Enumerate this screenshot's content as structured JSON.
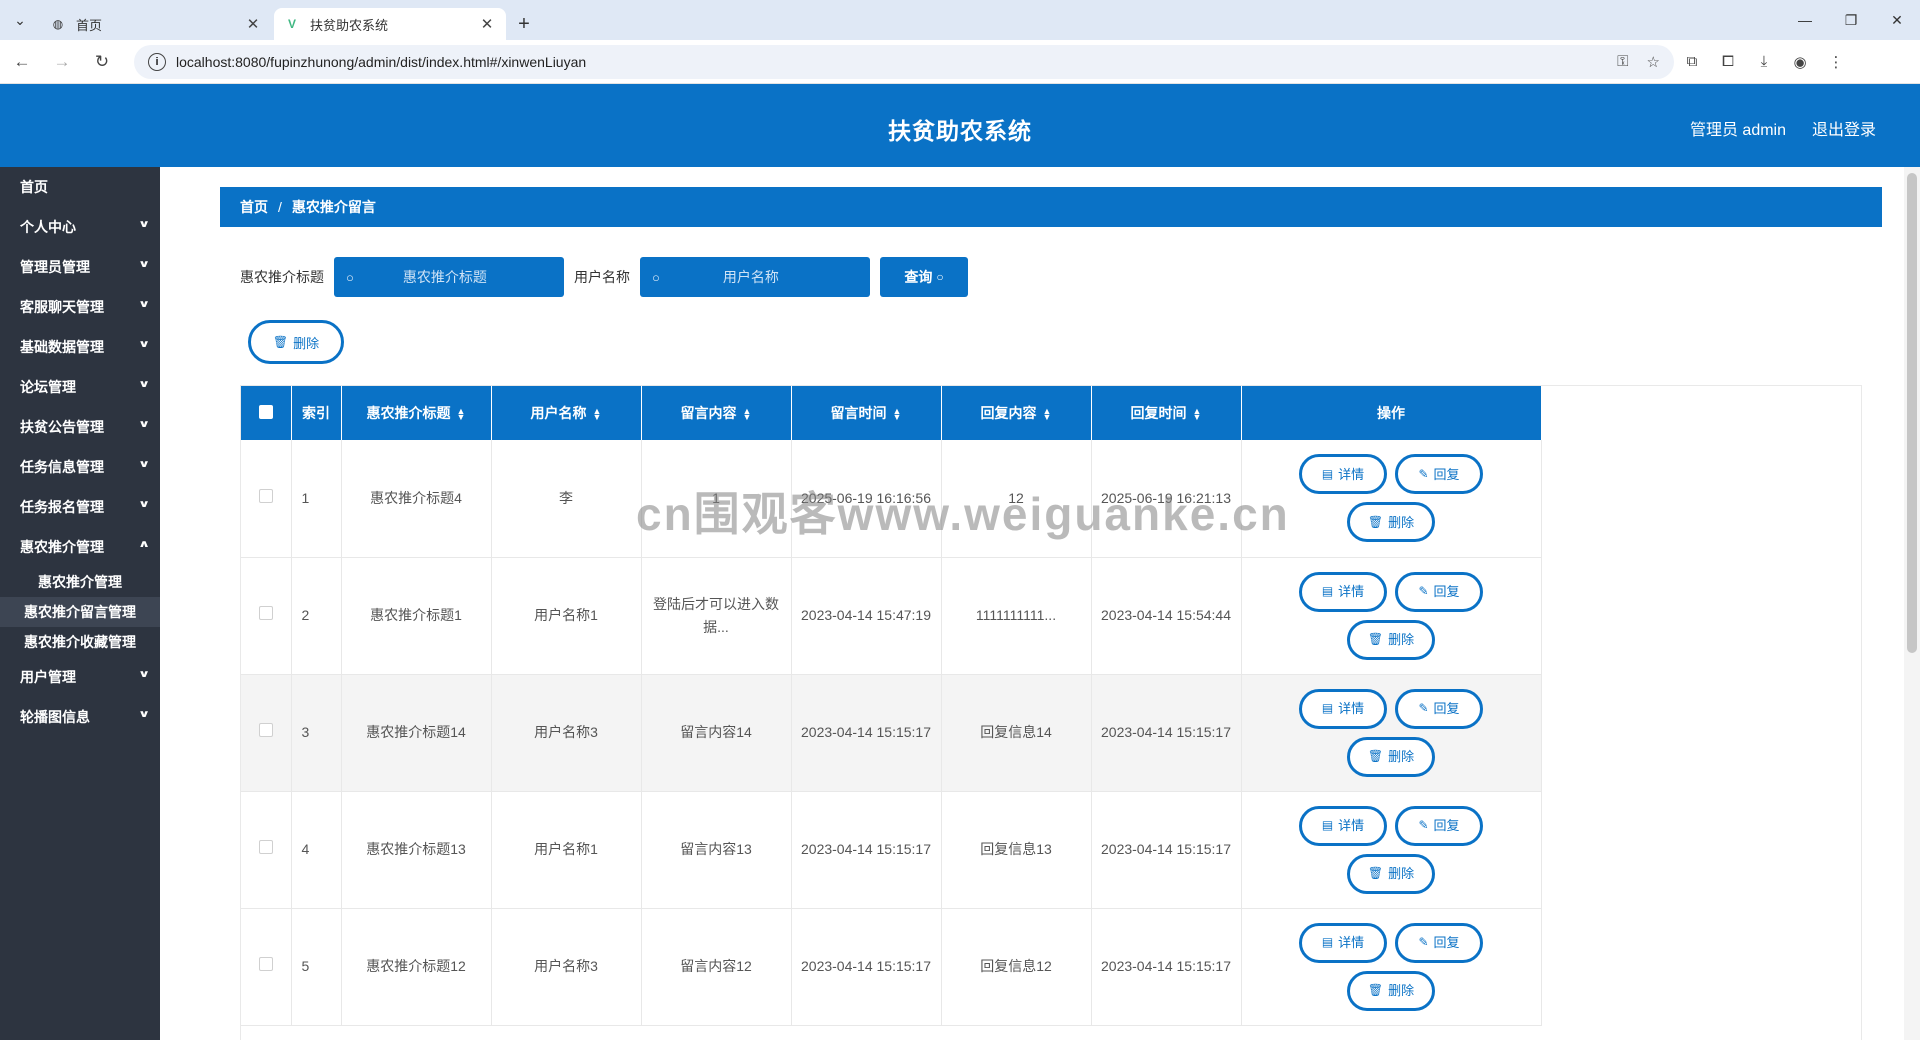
{
  "browser": {
    "tabs": [
      {
        "title": "首页",
        "active": false
      },
      {
        "title": "扶贫助农系统",
        "active": true
      }
    ],
    "url": "localhost:8080/fupinzhunong/admin/dist/index.html#/xinwenLiuyan"
  },
  "header": {
    "title": "扶贫助农系统",
    "user": "管理员 admin",
    "logout": "退出登录"
  },
  "sidebar": {
    "items": [
      {
        "label": "首页"
      },
      {
        "label": "个人中心"
      },
      {
        "label": "管理员管理"
      },
      {
        "label": "客服聊天管理"
      },
      {
        "label": "基础数据管理"
      },
      {
        "label": "论坛管理"
      },
      {
        "label": "扶贫公告管理"
      },
      {
        "label": "任务信息管理"
      },
      {
        "label": "任务报名管理"
      },
      {
        "label": "惠农推介管理"
      }
    ],
    "subitems": [
      {
        "label": "惠农推介管理"
      },
      {
        "label": "惠农推介留言管理"
      },
      {
        "label": "惠农推介收藏管理"
      }
    ],
    "items_after": [
      {
        "label": "用户管理"
      },
      {
        "label": "轮播图信息"
      }
    ]
  },
  "breadcrumb": {
    "home": "首页",
    "sep": "/",
    "current": "惠农推介留言"
  },
  "search": {
    "title_label": "惠农推介标题",
    "title_placeholder": "惠农推介标题",
    "user_label": "用户名称",
    "user_placeholder": "用户名称",
    "query_button": "查询"
  },
  "batch_delete": "删除",
  "table": {
    "columns": [
      "索引",
      "惠农推介标题",
      "用户名称",
      "留言内容",
      "留言时间",
      "回复内容",
      "回复时间",
      "操作"
    ],
    "rows": [
      {
        "idx": "1",
        "title": "惠农推介标题4",
        "user": "李",
        "content": "1",
        "time": "2025-06-19 16:16:56",
        "reply": "12",
        "reply_time": "2025-06-19 16:21:13"
      },
      {
        "idx": "2",
        "title": "惠农推介标题1",
        "user": "用户名称1",
        "content": "登陆后才可以进入数据...",
        "time": "2023-04-14 15:47:19",
        "reply": "1111111111...",
        "reply_time": "2023-04-14 15:54:44"
      },
      {
        "idx": "3",
        "title": "惠农推介标题14",
        "user": "用户名称3",
        "content": "留言内容14",
        "time": "2023-04-14 15:15:17",
        "reply": "回复信息14",
        "reply_time": "2023-04-14 15:15:17"
      },
      {
        "idx": "4",
        "title": "惠农推介标题13",
        "user": "用户名称1",
        "content": "留言内容13",
        "time": "2023-04-14 15:15:17",
        "reply": "回复信息13",
        "reply_time": "2023-04-14 15:15:17"
      },
      {
        "idx": "5",
        "title": "惠农推介标题12",
        "user": "用户名称3",
        "content": "留言内容12",
        "time": "2023-04-14 15:15:17",
        "reply": "回复信息12",
        "reply_time": "2023-04-14 15:15:17"
      }
    ],
    "ops": {
      "detail": "详情",
      "reply": "回复",
      "delete": "删除"
    }
  },
  "watermark": "cn围观客www.weiguanke.cn",
  "colors": {
    "primary": "#0a72c6",
    "sidebar": "#2d3440"
  }
}
